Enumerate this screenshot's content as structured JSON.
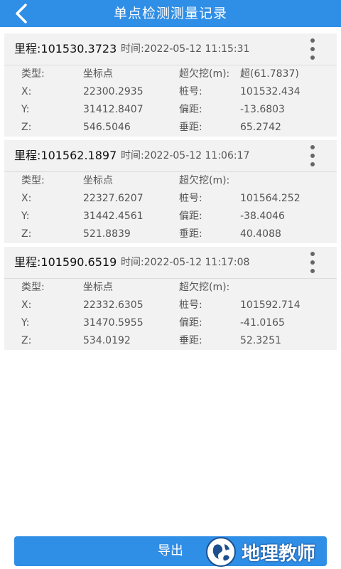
{
  "header": {
    "title": "单点检测测量记录"
  },
  "labels": {
    "type": "类型:",
    "x": "X:",
    "y": "Y:",
    "z": "Z:",
    "overunder": "超欠挖(m):",
    "station": "桩号:",
    "offset": "偏距:",
    "vertical": "垂距:"
  },
  "records": [
    {
      "mileage": "里程:101530.3723",
      "time": "时间:2022-05-12 11:15:31",
      "type_value": "坐标点",
      "overunder_value": "超(61.7837)",
      "x": "22300.2935",
      "y": "31412.8407",
      "z": "546.5046",
      "station": "101532.434",
      "offset": "-13.6803",
      "vertical": "65.2742"
    },
    {
      "mileage": "里程:101562.1897",
      "time": "时间:2022-05-12 11:06:17",
      "type_value": "坐标点",
      "overunder_value": "",
      "x": "22327.6207",
      "y": "31442.4561",
      "z": "521.8839",
      "station": "101564.252",
      "offset": "-38.4046",
      "vertical": "40.4088"
    },
    {
      "mileage": "里程:101590.6519",
      "time": "时间:2022-05-12 11:17:08",
      "type_value": "坐标点",
      "overunder_value": "",
      "x": "22332.6305",
      "y": "31470.5955",
      "z": "534.0192",
      "station": "101592.714",
      "offset": "-41.0165",
      "vertical": "52.3251"
    }
  ],
  "footer": {
    "export_label": "导出"
  },
  "watermark": {
    "text": "地理教师"
  },
  "colors": {
    "primary": "#2f8ee6",
    "card_bg": "#f2f2f2",
    "label": "#555555"
  }
}
